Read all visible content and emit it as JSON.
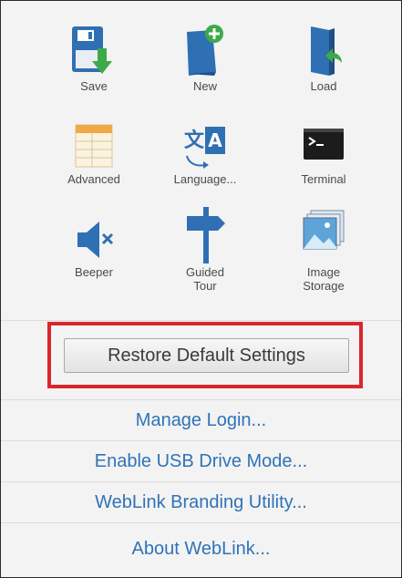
{
  "icons": [
    {
      "label": "Save",
      "icon": "save-icon"
    },
    {
      "label": "New",
      "icon": "new-document-icon"
    },
    {
      "label": "Load",
      "icon": "load-icon"
    },
    {
      "label": "Advanced",
      "icon": "advanced-settings-icon"
    },
    {
      "label": "Language...",
      "icon": "language-icon"
    },
    {
      "label": "Terminal",
      "icon": "terminal-icon"
    },
    {
      "label": "Beeper",
      "icon": "beeper-muted-icon"
    },
    {
      "label": "Guided\nTour",
      "icon": "signpost-icon"
    },
    {
      "label": "Image\nStorage",
      "icon": "image-storage-icon"
    }
  ],
  "restore_button": "Restore Default Settings",
  "links": [
    "Manage Login...",
    "Enable USB Drive Mode...",
    "WebLink Branding Utility...",
    "About WebLink..."
  ],
  "colors": {
    "link": "#2f73b8",
    "highlight_border": "#d9262c",
    "icon_blue": "#2f6fb3",
    "icon_green": "#3daa49"
  }
}
